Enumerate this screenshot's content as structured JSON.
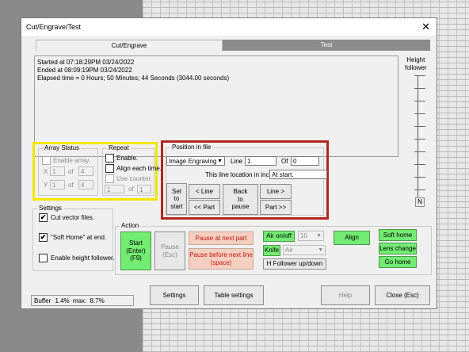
{
  "window": {
    "title": "Cut/Engrave/Test",
    "close": "✕"
  },
  "tabs": [
    {
      "label": "Cut/Engrave"
    },
    {
      "label": "Test"
    }
  ],
  "log": {
    "lines": [
      "Started at 07:18:29PM 03/24/2022",
      "Ended at 08:09:19PM 03/24/2022",
      " Elapsed time = 0 Hours; 50 Minutes; 44 Seconds (3044.00 seconds)"
    ]
  },
  "height_follower": {
    "label": "Height\nfollower",
    "n_label": "N"
  },
  "array_status": {
    "title": "Array Status",
    "enable_label": "Enable array.",
    "x_label": "X",
    "x_value": "1",
    "x_of": "of",
    "x_total": "4",
    "y_label": "Y",
    "y_value": "1",
    "y_of": "of",
    "y_total": "4"
  },
  "repeat": {
    "title": "Repeat",
    "enable_label": "Enable.",
    "align_label": "Align each time.",
    "counter_label": "Use counter.",
    "count_value": "1",
    "count_of": "of",
    "count_total": "1"
  },
  "position": {
    "title": "Position in file",
    "mode": "Image Engraving",
    "line_label": "Line",
    "line_value": "1",
    "of_label": "Of",
    "of_value": "0",
    "location_label": "This line location in inches",
    "location_value": "At start.",
    "set_to_start": "Set\nto\nstart",
    "line_back": "< Line",
    "part_back": "<< Part",
    "back_to_pause": "Back\nto\npause",
    "line_fwd": "Line >",
    "part_fwd": "Part >>"
  },
  "settings": {
    "title": "Settings",
    "cut_vector_label": "Cut vector files.",
    "cut_vector_checked": "✔",
    "soft_home_label": "\"Soft Home\" at end.",
    "soft_home_checked": "✔",
    "height_follower_label": "Enable height follower."
  },
  "action": {
    "title": "Action",
    "start": "Start\n(Enter)(F9)",
    "pause": "Pause\n(Esc)",
    "pause_next_part": "Pause at next part",
    "pause_next_line": "Pause before next line\n(space)",
    "air_onoff": "Air on/off",
    "air_value": "10",
    "knife": "Knife",
    "knife_value": "Air",
    "h_follower": "H Follower up/down",
    "align": "Align",
    "soft_home": "Soft home",
    "lens_change": "Lens change",
    "go_home": "Go home"
  },
  "bottom": {
    "buffer_label": "Buffer",
    "buffer_value": "1.4%",
    "max_label": "max:",
    "max_value": "8.7%",
    "settings": "Settings",
    "table_settings": "Table settings",
    "help": "Help",
    "close": "Close (Esc)"
  },
  "colors": {
    "green": "#72ec72",
    "pink": "#f5cfc0",
    "highlight_yellow": "#f2e600",
    "highlight_red": "#b3261e"
  }
}
